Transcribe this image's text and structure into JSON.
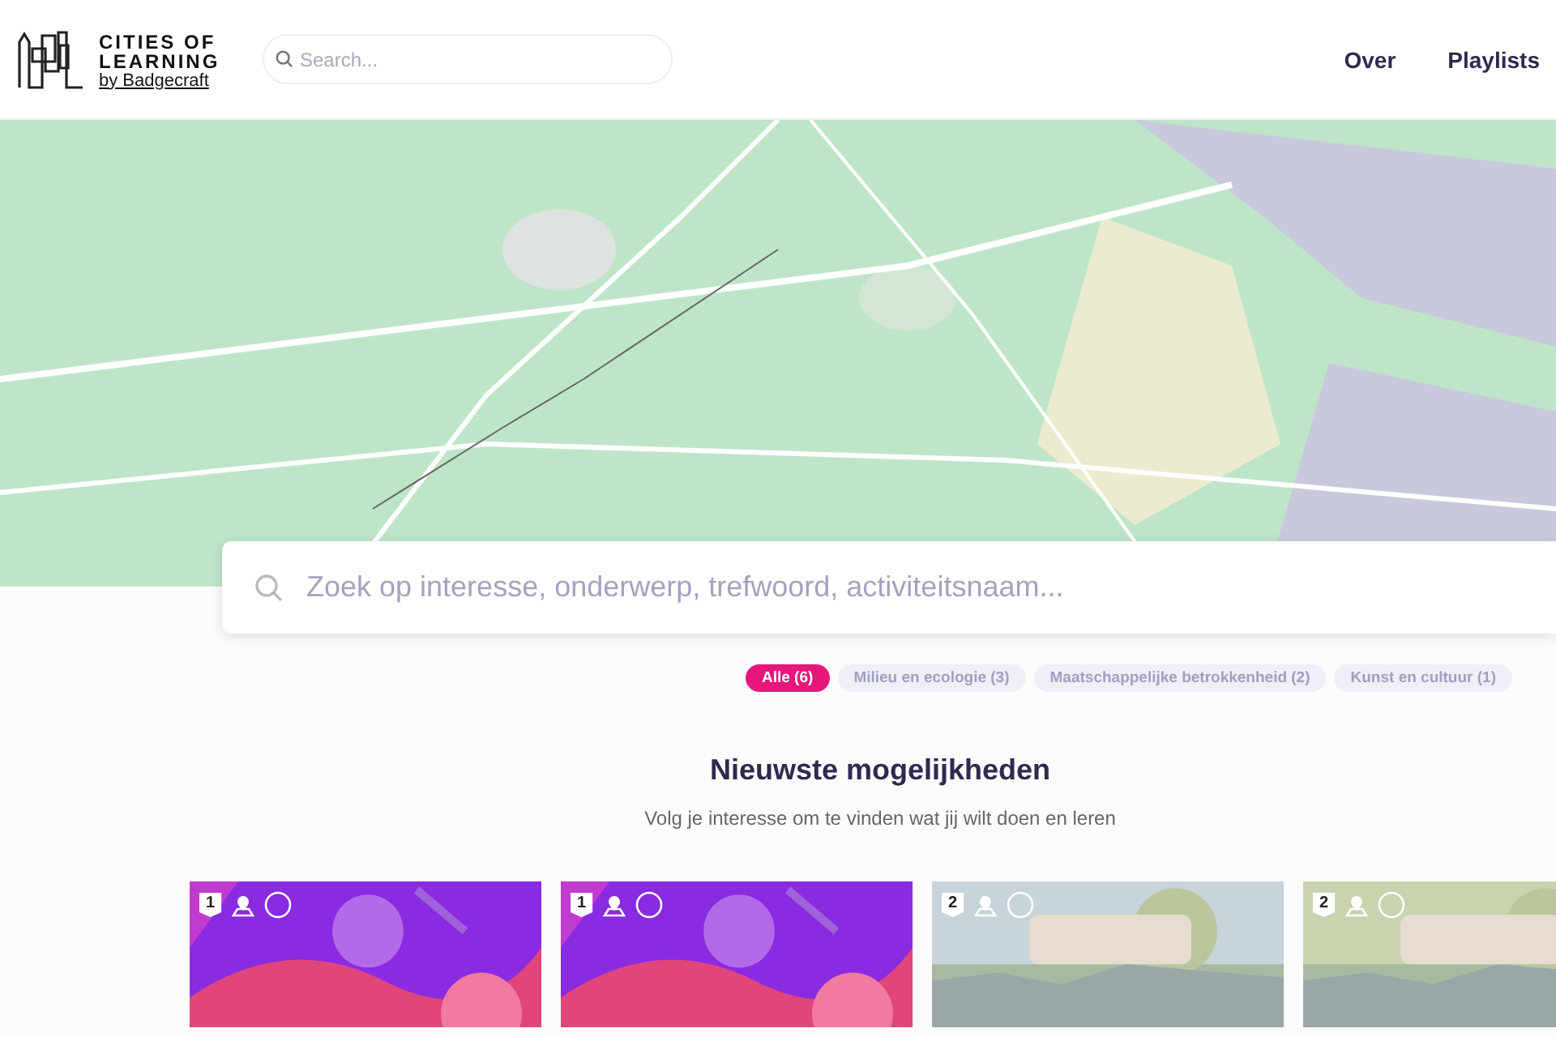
{
  "header": {
    "logo": {
      "line_1": "CITIES OF",
      "line_2": "LEARNING",
      "line_3": "by Badgecraft"
    },
    "search": {
      "placeholder": "Search..."
    },
    "nav": [
      "Over",
      "Playlists"
    ]
  },
  "main_search": {
    "placeholder": "Zoek op interesse, onderwerp, trefwoord, activiteitsnaam..."
  },
  "filters": [
    {
      "label": "Alle (6)",
      "selected": true
    },
    {
      "label": "Milieu en ecologie (3)",
      "selected": false
    },
    {
      "label": "Maatschappelijke betrokkenheid (2)",
      "selected": false
    },
    {
      "label": "Kunst en cultuur (1)",
      "selected": false
    }
  ],
  "section": {
    "title": "Nieuwste mogelijkheden",
    "subtitle": "Volg je interesse om te vinden wat jij wilt doen en leren"
  },
  "cards": [
    {
      "level": "1",
      "color": "#8a2be2"
    },
    {
      "level": "1",
      "color": "#8a2be2"
    },
    {
      "level": "2",
      "color": "#c9d3da"
    },
    {
      "level": "2",
      "color": "#c8d3b0"
    }
  ]
}
